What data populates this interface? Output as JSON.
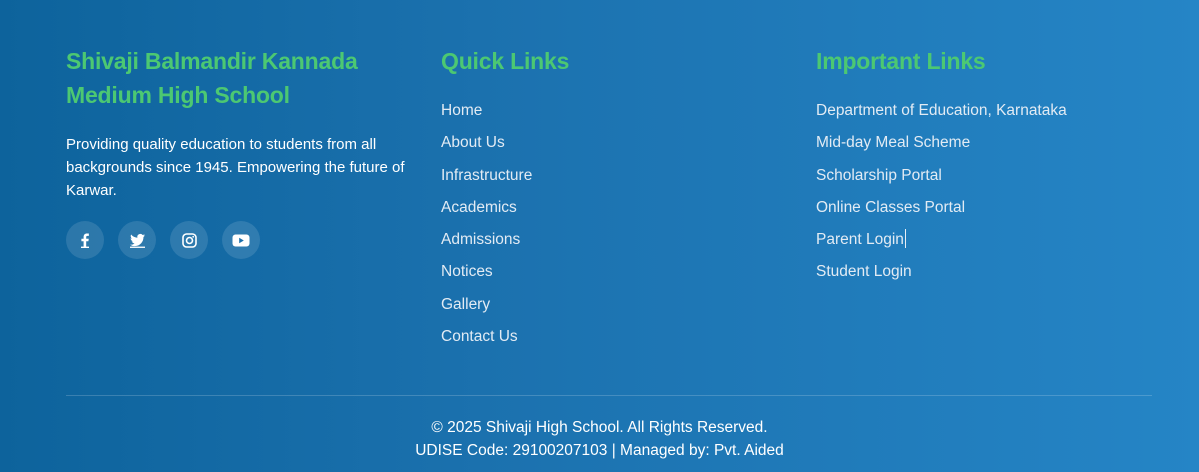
{
  "about": {
    "title_line1": "Shivaji Balmandir Kannada",
    "title_line2": "Medium High School",
    "description": "Providing quality education to students from all backgrounds since 1945. Empowering the future of Karwar.",
    "socials": [
      {
        "icon": "facebook-icon"
      },
      {
        "icon": "twitter-icon"
      },
      {
        "icon": "instagram-icon"
      },
      {
        "icon": "youtube-icon"
      }
    ]
  },
  "quick_links": {
    "heading": "Quick Links",
    "items": [
      "Home",
      "About Us",
      "Infrastructure",
      "Academics",
      "Admissions",
      "Notices",
      "Gallery",
      "Contact Us"
    ]
  },
  "important_links": {
    "heading": "Important Links",
    "items": [
      "Department of Education, Karnataka",
      "Mid-day Meal Scheme",
      "Scholarship Portal",
      "Online Classes Portal",
      "Parent Login",
      "Student Login"
    ]
  },
  "bottom": {
    "copyright": "© 2025 Shivaji High School. All Rights Reserved.",
    "udise": "UDISE Code: 29100207103 | Managed by: Pvt. Aided"
  },
  "colors": {
    "accent": "#4cc872",
    "background_start": "#0d639c",
    "background_end": "#2585c6"
  }
}
